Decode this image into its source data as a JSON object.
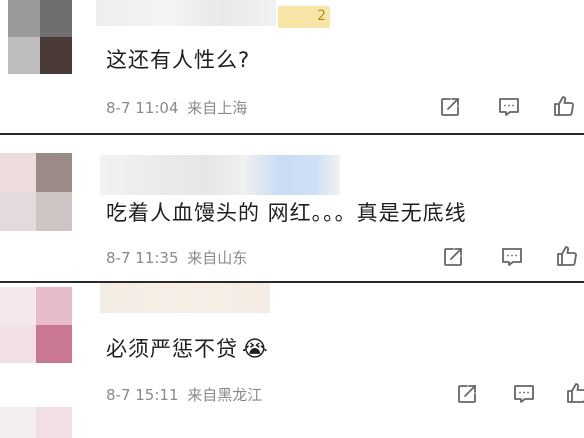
{
  "comments": [
    {
      "text": "这还有人性么?",
      "date": "8-7 11:04",
      "location": "来自上海",
      "badge": "2",
      "icons": [
        "share-icon",
        "comment-icon",
        "like-icon"
      ]
    },
    {
      "text": "吃着人血馒头的 网红。。。真是无底线",
      "date": "8-7 11:35",
      "location": "来自山东",
      "icons": [
        "share-icon",
        "comment-icon",
        "like-icon"
      ]
    },
    {
      "text": "必须严惩不贷",
      "emoji": "😭",
      "date": "8-7 15:11",
      "location": "来自黑龙江",
      "icons": [
        "share-icon",
        "comment-icon",
        "like-icon"
      ]
    }
  ],
  "colors": {
    "text": "#1f1f1f",
    "meta": "#8a8a8a",
    "icon": "#666666",
    "divider": "#2a2a2a"
  }
}
